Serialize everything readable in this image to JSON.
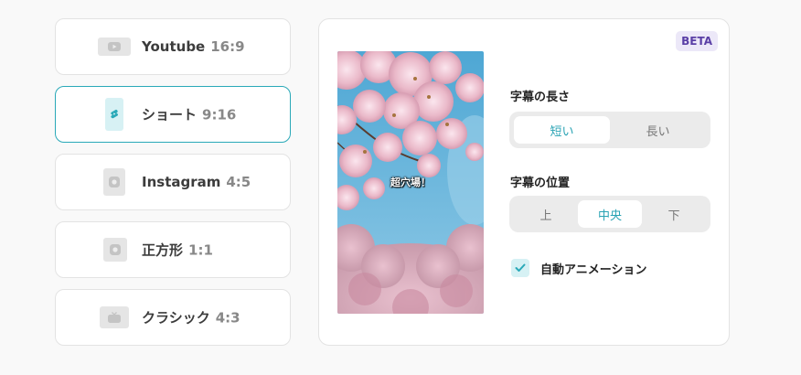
{
  "ratios": [
    {
      "label": "Youtube",
      "ratio": "16:9",
      "icon": "youtube-icon",
      "active": false
    },
    {
      "label": "ショート",
      "ratio": "9:16",
      "icon": "shorts-icon",
      "active": true
    },
    {
      "label": "Instagram",
      "ratio": "4:5",
      "icon": "instagram-icon",
      "active": false
    },
    {
      "label": "正方形",
      "ratio": "1:1",
      "icon": "square-icon",
      "active": false
    },
    {
      "label": "クラシック",
      "ratio": "4:3",
      "icon": "tv-icon",
      "active": false
    }
  ],
  "panel": {
    "badge": "BETA",
    "preview_caption": "超穴場！",
    "subtitle_length": {
      "label": "字幕の長さ",
      "options": [
        "短い",
        "長い"
      ],
      "selected": "短い"
    },
    "subtitle_position": {
      "label": "字幕の位置",
      "options": [
        "上",
        "中央",
        "下"
      ],
      "selected": "中央"
    },
    "auto_animation": {
      "label": "自動アニメーション",
      "checked": true
    }
  },
  "colors": {
    "accent": "#2aa9b8",
    "badge_bg": "#ece8f8",
    "badge_text": "#5a3fa6"
  }
}
